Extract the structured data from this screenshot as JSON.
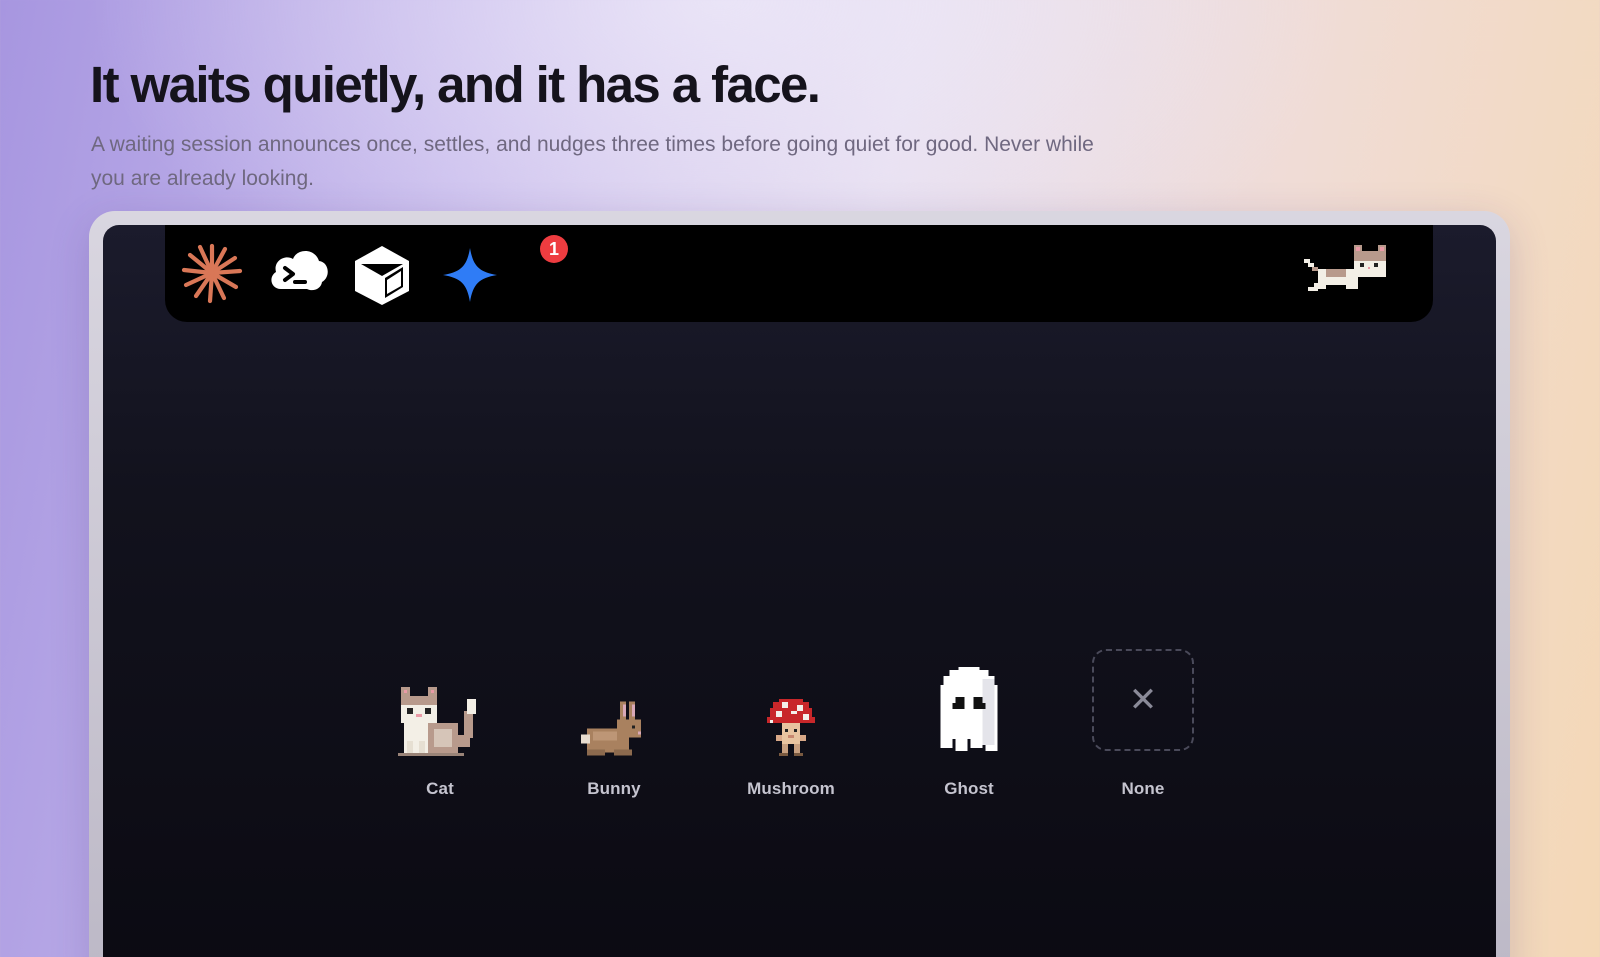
{
  "hero": {
    "title": "It waits quietly, and it has a face.",
    "subtitle": "A waiting session announces once, settles, and nudges three times before going quiet for good. Never while you are already looking."
  },
  "menubar": {
    "apps": [
      {
        "icon": "claude-asterisk-icon",
        "color": "#d97757"
      },
      {
        "icon": "cloud-terminal-icon",
        "color": "#ffffff"
      },
      {
        "icon": "cube-icon",
        "color": "#ffffff"
      },
      {
        "icon": "sparkle-icon",
        "color": "#2f7cf6",
        "badge": "1"
      }
    ],
    "pet": "cat-pixel-icon",
    "badge_color": "#ee3c40"
  },
  "pets": {
    "options": [
      {
        "label": "Cat",
        "icon": "cat-pixel-icon"
      },
      {
        "label": "Bunny",
        "icon": "bunny-pixel-icon"
      },
      {
        "label": "Mushroom",
        "icon": "mushroom-pixel-icon"
      },
      {
        "label": "Ghost",
        "icon": "ghost-pixel-icon"
      },
      {
        "label": "None",
        "icon": "close-icon"
      }
    ]
  }
}
